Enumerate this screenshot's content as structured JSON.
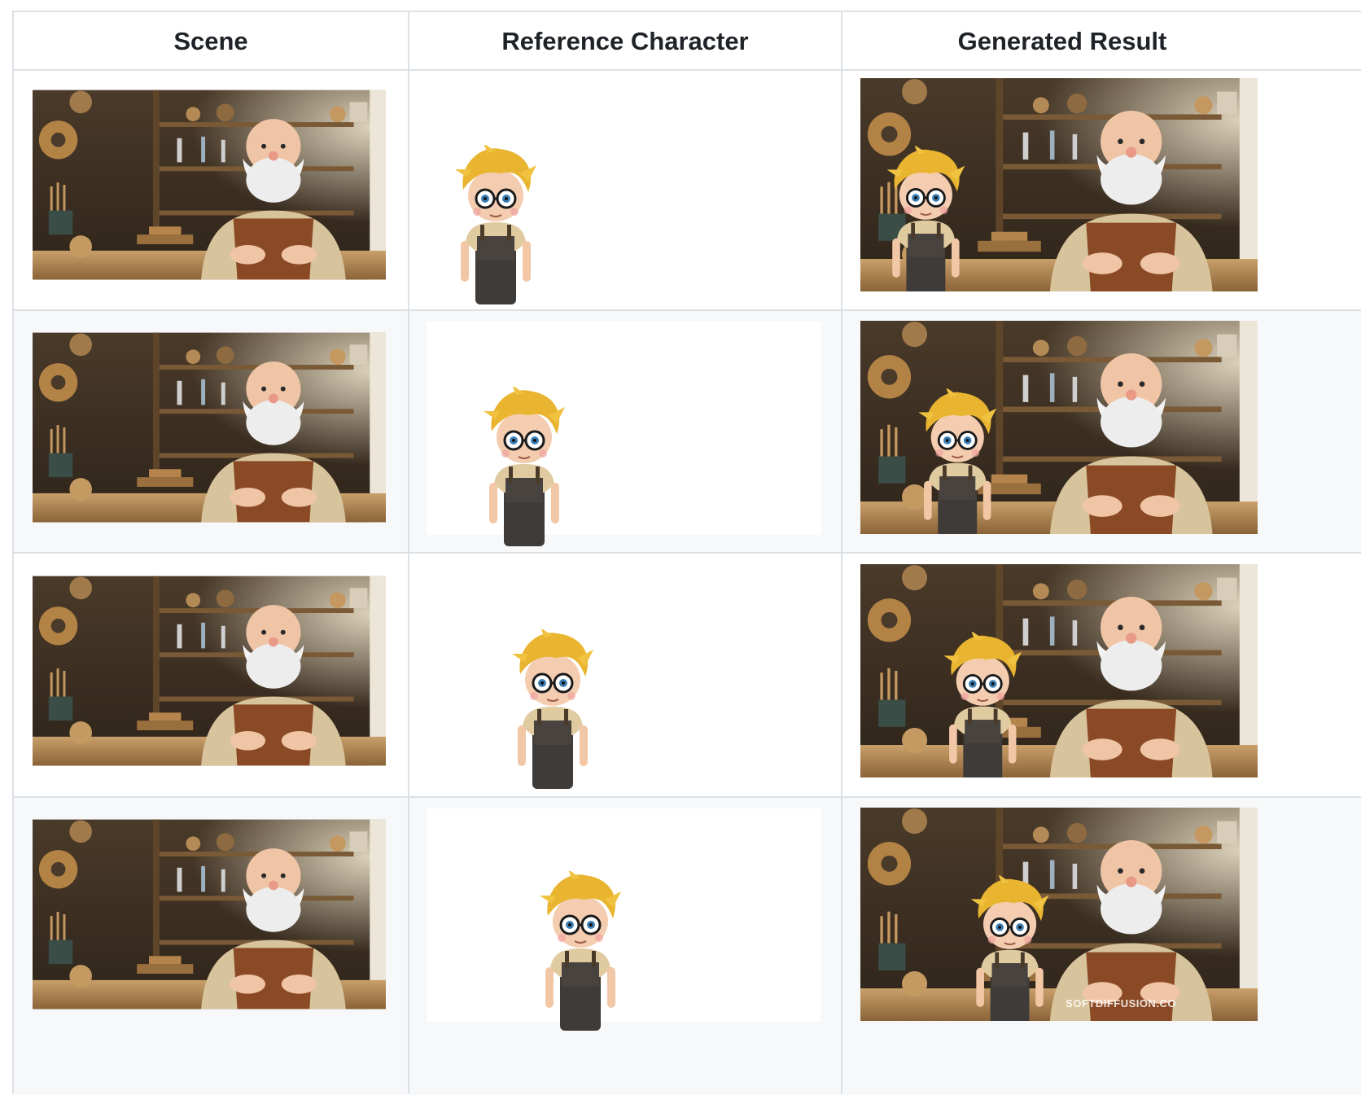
{
  "table": {
    "headers": {
      "scene": "Scene",
      "reference": "Reference Character",
      "result": "Generated Result"
    },
    "rows": [
      {
        "scene": "workshop-scene-image",
        "reference": "boy-character-image",
        "result": "generated-composite-image"
      },
      {
        "scene": "workshop-scene-image",
        "reference": "boy-character-image",
        "result": "generated-composite-image"
      },
      {
        "scene": "workshop-scene-image",
        "reference": "boy-character-image",
        "result": "generated-composite-image"
      },
      {
        "scene": "workshop-scene-image",
        "reference": "boy-character-image",
        "result": "generated-composite-image"
      }
    ],
    "watermark": "SOFTDIFFUSION.CO"
  },
  "colors": {
    "border": "#dce1e6",
    "alt_row": "#f6f8fa",
    "header_text": "#1f2328"
  }
}
